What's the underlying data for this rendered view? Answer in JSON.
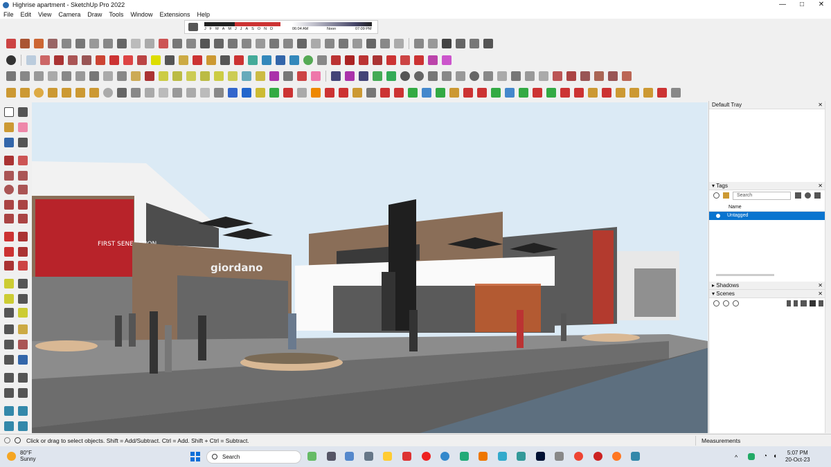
{
  "window": {
    "title": "Highrise apartment - SketchUp Pro 2022",
    "controls": [
      "—",
      "□",
      "✕"
    ]
  },
  "menu": [
    "File",
    "Edit",
    "View",
    "Camera",
    "Draw",
    "Tools",
    "Window",
    "Extensions",
    "Help"
  ],
  "shadow_settings": {
    "months": [
      "J",
      "F",
      "M",
      "A",
      "M",
      "J",
      "J",
      "A",
      "S",
      "O",
      "N",
      "D"
    ],
    "sunrise": "06:04 AM",
    "noon": "Noon",
    "sunset": "07:09 PM"
  },
  "viewport": {
    "storefront_sign": "giordano",
    "billboard_text": "FIRST SENERATION"
  },
  "tray": {
    "title": "Default Tray",
    "tags_panel": {
      "title": "Tags",
      "search_placeholder": "Search",
      "column_name": "Name",
      "rows": [
        "Untagged"
      ]
    },
    "shadows_panel": {
      "title": "Shadows"
    },
    "scenes_panel": {
      "title": "Scenes"
    }
  },
  "status_bar": {
    "message": "Click or drag to select objects. Shift = Add/Subtract. Ctrl = Add. Shift + Ctrl = Subtract.",
    "measurements_label": "Measurements"
  },
  "taskbar": {
    "weather_temp": "80°F",
    "weather_condition": "Sunny",
    "search_label": "Search",
    "time": "5:07 PM",
    "date": "20-Oct-23"
  },
  "colors": {
    "accent": "#0a74cf",
    "sky": "#dbeaf5",
    "tag_selected": "#0a74cf"
  }
}
